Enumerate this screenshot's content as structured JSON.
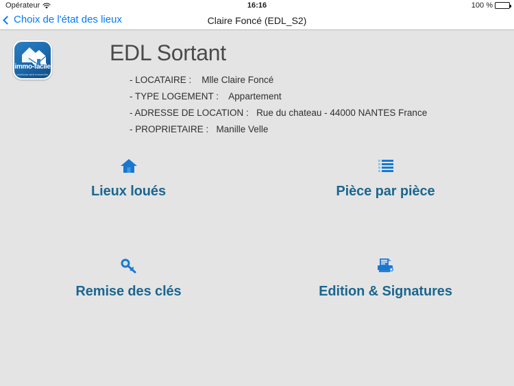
{
  "status_bar": {
    "carrier": "Opérateur",
    "wifi_icon": "wifi-icon",
    "time": "16:16",
    "battery_text": "100 %",
    "battery_icon": "battery-full-icon"
  },
  "nav_bar": {
    "back_icon": "chevron-left-icon",
    "back_label": "Choix de l'état des lieux",
    "title": "Claire Foncé (EDL_S2)"
  },
  "logo": {
    "icon": "house-logo-icon",
    "name": "immo-facile",
    "tagline": "solutions web immobilier"
  },
  "main": {
    "heading": "EDL Sortant",
    "details": [
      {
        "label": "- LOCATAIRE :",
        "value": "Mlle Claire Foncé"
      },
      {
        "label": "- TYPE LOGEMENT :",
        "value": "Appartement"
      },
      {
        "label": "- ADRESSE DE LOCATION :",
        "value": "Rue du chateau - 44000 NANTES France"
      },
      {
        "label": "- PROPRIETAIRE :",
        "value": "Manille Velle"
      }
    ],
    "tiles": [
      {
        "label": "Lieux loués",
        "icon": "house-icon"
      },
      {
        "label": "Pièce par pièce",
        "icon": "list-icon"
      },
      {
        "label": "Remise des clés",
        "icon": "key-icon"
      },
      {
        "label": "Edition & Signatures",
        "icon": "printer-icon"
      }
    ]
  },
  "colors": {
    "accent_blue": "#007aff",
    "icon_blue": "#1878d0",
    "label_blue": "#1b6690",
    "background": "#e4e4e4",
    "bar_background": "#ffffff",
    "heading_gray": "#4a4a4a"
  }
}
